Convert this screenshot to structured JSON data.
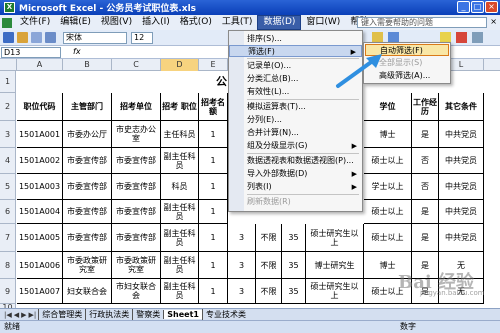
{
  "window": {
    "title": "Microsoft Excel - 公务员考试职位表.xls",
    "app_icon": "X"
  },
  "menubar": {
    "items": [
      "文件(F)",
      "编辑(E)",
      "视图(V)",
      "插入(I)",
      "格式(O)",
      "工具(T)",
      "数据(D)",
      "窗口(W)",
      "帮助(H)"
    ],
    "help_placeholder": "键入需要帮助的问题",
    "active": "数据(D)"
  },
  "toolbar": {
    "font_name": "宋体",
    "font_size": "12"
  },
  "formulabar": {
    "cell_ref": "D13",
    "fx": "fx"
  },
  "sheet": {
    "columns": [
      "A",
      "B",
      "C",
      "D",
      "E",
      "F",
      "G",
      "H",
      "I",
      "J",
      "K",
      "L"
    ],
    "row_numbers": [
      "1",
      "2",
      "3",
      "4",
      "5",
      "6",
      "7",
      "8",
      "9",
      "10"
    ],
    "title_fragment": "公",
    "headers": [
      "职位代码",
      "主管部门",
      "招考单位",
      "招考 职位",
      "招考名额",
      "学位",
      "工作经历",
      "其它条件"
    ],
    "rows": [
      {
        "code": "1501A001",
        "dept": "市委办公厅",
        "unit": "市史志办公室",
        "position": "主任科员",
        "count": "1",
        "extra": [
          "",
          "",
          "",
          "",
          "博士",
          "是",
          "中共党员"
        ]
      },
      {
        "code": "1501A002",
        "dept": "市委宣传部",
        "unit": "市委宣传部",
        "position": "副主任科员",
        "count": "1",
        "extra": [
          "",
          "",
          "",
          "",
          "硕士以上",
          "否",
          "中共党员"
        ]
      },
      {
        "code": "1501A003",
        "dept": "市委宣传部",
        "unit": "市委宣传部",
        "position": "科员",
        "count": "1",
        "extra": [
          "",
          "",
          "",
          "",
          "学士以上",
          "否",
          "中共党员"
        ]
      },
      {
        "code": "1501A004",
        "dept": "市委宣传部",
        "unit": "市委宣传部",
        "position": "副主任科员",
        "count": "1",
        "extra": [
          "",
          "",
          "",
          "",
          "硕士以上",
          "是",
          "中共党员"
        ]
      },
      {
        "code": "1501A005",
        "dept": "市委宣传部",
        "unit": "市委宣传部",
        "position": "副主任科员",
        "count": "1",
        "extra": [
          "3",
          "不限",
          "35",
          "硕士研究生以上",
          "硕士以上",
          "是",
          "中共党员"
        ]
      },
      {
        "code": "1501A006",
        "dept": "市委政策研究室",
        "unit": "市委政策研究室",
        "position": "副主任科员",
        "count": "1",
        "extra": [
          "3",
          "不限",
          "35",
          "博士研究生",
          "博士",
          "是",
          "无"
        ]
      },
      {
        "code": "1501A007",
        "dept": "妇女联合会",
        "unit": "市妇女联合会",
        "position": "副主任科员",
        "count": "1",
        "extra": [
          "3",
          "不限",
          "35",
          "硕士研究生以上",
          "硕士以上",
          "是",
          "无"
        ]
      }
    ]
  },
  "data_menu": {
    "items": [
      "排序(S)...",
      "筛选(F)",
      "记录单(O)...",
      "分类汇总(B)...",
      "有效性(L)...",
      "模拟运算表(T)...",
      "分列(E)...",
      "合并计算(N)...",
      "组及分级显示(G)",
      "数据透视表和数据透视图(P)...",
      "导入外部数据(D)",
      "列表(I)",
      "刷新数据(R)"
    ]
  },
  "filter_submenu": {
    "items": [
      "自动筛选(F)",
      "全部显示(S)",
      "高级筛选(A)..."
    ]
  },
  "sheet_tabs": [
    "综合管理类",
    "行政执法类",
    "警察类",
    "Sheet1",
    "专业技术类"
  ],
  "status": {
    "left": "就绪",
    "right": "数字"
  },
  "watermark": {
    "brand": "Bai 经验",
    "url": "jingyan.baidu.com"
  },
  "colors": {
    "title_bar": "#0a3fb8",
    "menu_highlight": "#c8d7ef",
    "submenu_highlight": "#f9e7a6",
    "annotation_arrow": "#2f8fe0"
  }
}
